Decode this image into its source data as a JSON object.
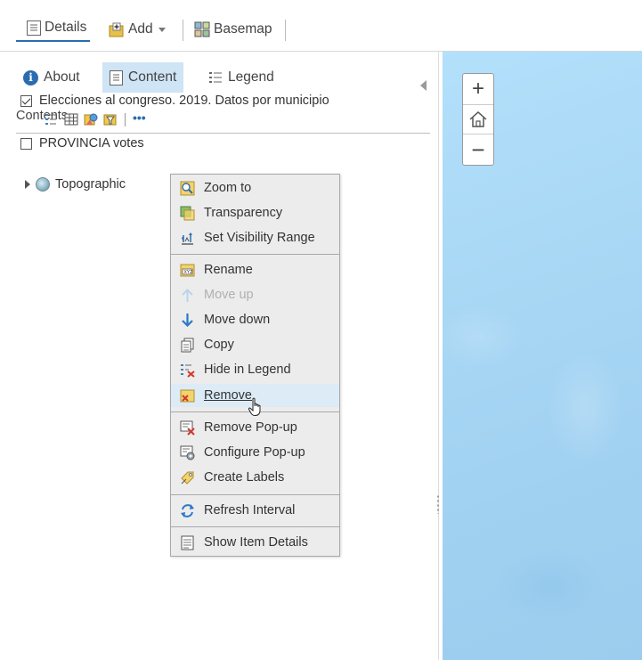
{
  "toolbar": {
    "details_label": "Details",
    "add_label": "Add",
    "basemap_label": "Basemap"
  },
  "tabs": {
    "about": "About",
    "content": "Content",
    "legend": "Legend"
  },
  "contents_title": "Contents",
  "layers": [
    {
      "name": "Elecciones al congreso. 2019. Datos por municipio",
      "checked": true
    },
    {
      "name": "PROVINCIA votes",
      "checked": false
    },
    {
      "name": "Topographic",
      "basemap": true
    }
  ],
  "context_menu": {
    "items": [
      {
        "label": "Zoom to",
        "icon": "zoom-to-icon"
      },
      {
        "label": "Transparency",
        "icon": "transparency-icon"
      },
      {
        "label": "Set Visibility Range",
        "icon": "visibility-range-icon"
      },
      {
        "label": "Rename",
        "icon": "rename-icon"
      },
      {
        "label": "Move up",
        "icon": "arrow-up-icon",
        "disabled": true
      },
      {
        "label": "Move down",
        "icon": "arrow-down-icon"
      },
      {
        "label": "Copy",
        "icon": "copy-icon"
      },
      {
        "label": "Hide in Legend",
        "icon": "hide-legend-icon"
      },
      {
        "label": "Remove",
        "icon": "remove-icon",
        "hovered": true
      },
      {
        "label": "Remove Pop-up",
        "icon": "remove-popup-icon"
      },
      {
        "label": "Configure Pop-up",
        "icon": "configure-popup-icon"
      },
      {
        "label": "Create Labels",
        "icon": "create-labels-icon"
      },
      {
        "label": "Refresh Interval",
        "icon": "refresh-icon"
      },
      {
        "label": "Show Item Details",
        "icon": "item-details-icon"
      }
    ]
  },
  "map_controls": {
    "zoom_in": "+",
    "zoom_out": "−"
  },
  "colors": {
    "accent": "#2b6cb0",
    "selected_tab": "#cfe4f5",
    "map_water": "#a9d8f5",
    "menu_bg": "#ececec"
  }
}
